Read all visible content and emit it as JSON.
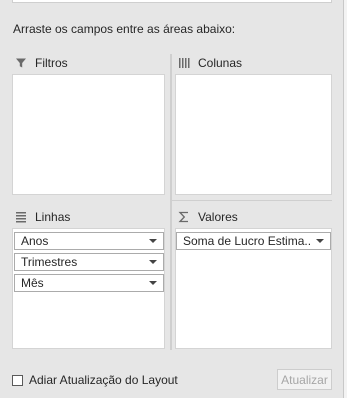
{
  "instruction": "Arraste os campos entre as áreas abaixo:",
  "areas": {
    "filters": {
      "title": "Filtros",
      "icon": "filter-icon"
    },
    "columns": {
      "title": "Colunas",
      "icon": "columns-icon"
    },
    "rows": {
      "title": "Linhas",
      "icon": "rows-icon",
      "fields": [
        {
          "label": "Anos"
        },
        {
          "label": "Trimestres"
        },
        {
          "label": "Mês"
        }
      ]
    },
    "values": {
      "title": "Valores",
      "icon": "sigma-icon",
      "fields": [
        {
          "label": "Soma de Lucro Estima..."
        }
      ]
    }
  },
  "footer": {
    "defer_label": "Adiar Atualização do Layout",
    "defer_checked": false,
    "update_label": "Atualizar"
  },
  "colors": {
    "panel_bg": "#e6e6e6",
    "box_bg": "#ffffff",
    "disabled_text": "#a6a6a6"
  }
}
